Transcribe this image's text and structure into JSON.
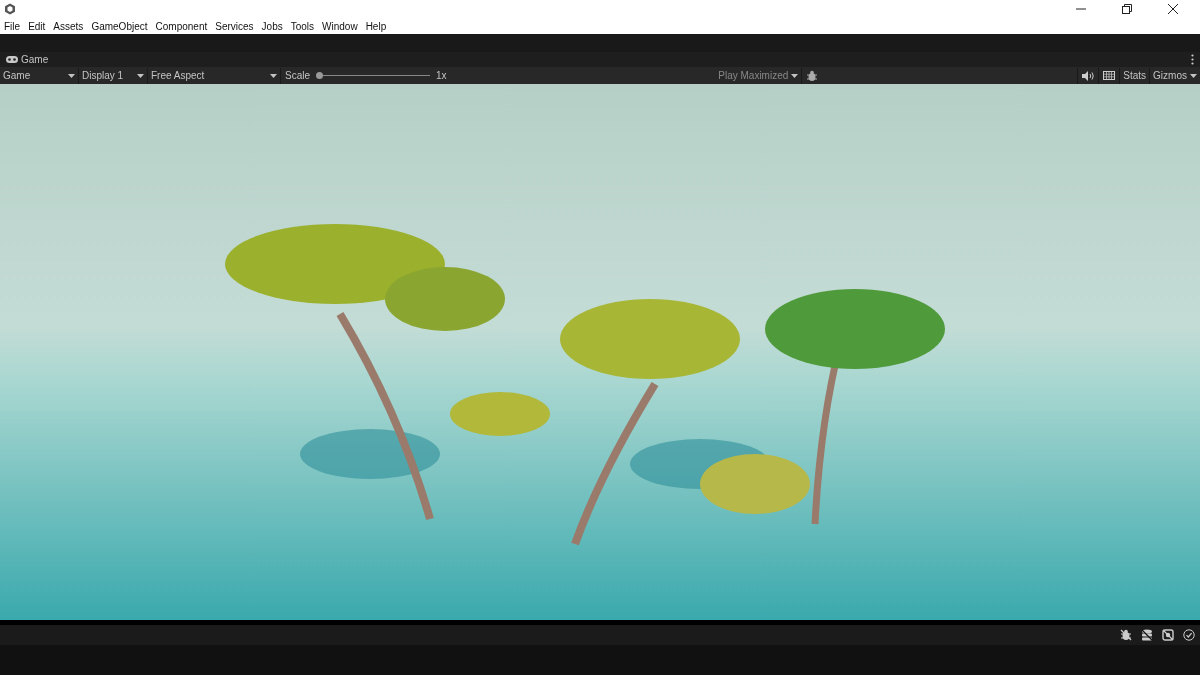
{
  "menu_bar": {
    "items": [
      "File",
      "Edit",
      "Assets",
      "GameObject",
      "Component",
      "Services",
      "Jobs",
      "Tools",
      "Window",
      "Help"
    ]
  },
  "tab": {
    "title": "Game"
  },
  "toolbar": {
    "view_mode": "Game",
    "display": "Display 1",
    "aspect": "Free Aspect",
    "scale": {
      "label": "Scale",
      "level": 0,
      "reading": "1x"
    },
    "play_mode": "Play Maximized",
    "stats": "Stats",
    "gizmos": "Gizmos"
  }
}
